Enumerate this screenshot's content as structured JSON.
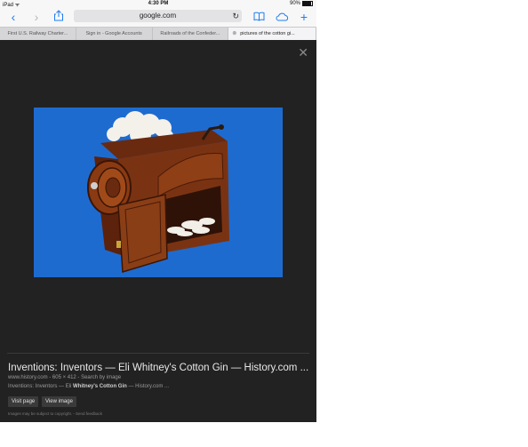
{
  "status_bar": {
    "device": "iPad",
    "time": "4:30 PM",
    "battery": "90%"
  },
  "toolbar": {
    "url": "google.com"
  },
  "tabs": [
    {
      "label": "First U.S. Railway Charter..."
    },
    {
      "label": "Sign in - Google Accounts"
    },
    {
      "label": "Railroads of the Confeder..."
    },
    {
      "label": "pictures of the cotton gi..."
    }
  ],
  "viewer": {
    "title": "Inventions: Inventors — Eli Whitney's Cotton Gin — History.com ...",
    "source": "www.history.com - 605 × 412 - Search by image",
    "snippet_prefix": "Inventions: Inventors — Eli ",
    "snippet_bold": "Whitney's Cotton Gin",
    "snippet_suffix": " — History.com ...",
    "visit_page": "Visit page",
    "view_image": "View image",
    "legal": "Images may be subject to copyright. - Send feedback",
    "photo_bg": "#1e6bd0"
  },
  "icons": [
    "back-icon",
    "forward-icon",
    "share-icon",
    "reload-icon",
    "bookmarks-icon",
    "icloud-tabs-icon",
    "new-tab-icon",
    "close-icon"
  ]
}
